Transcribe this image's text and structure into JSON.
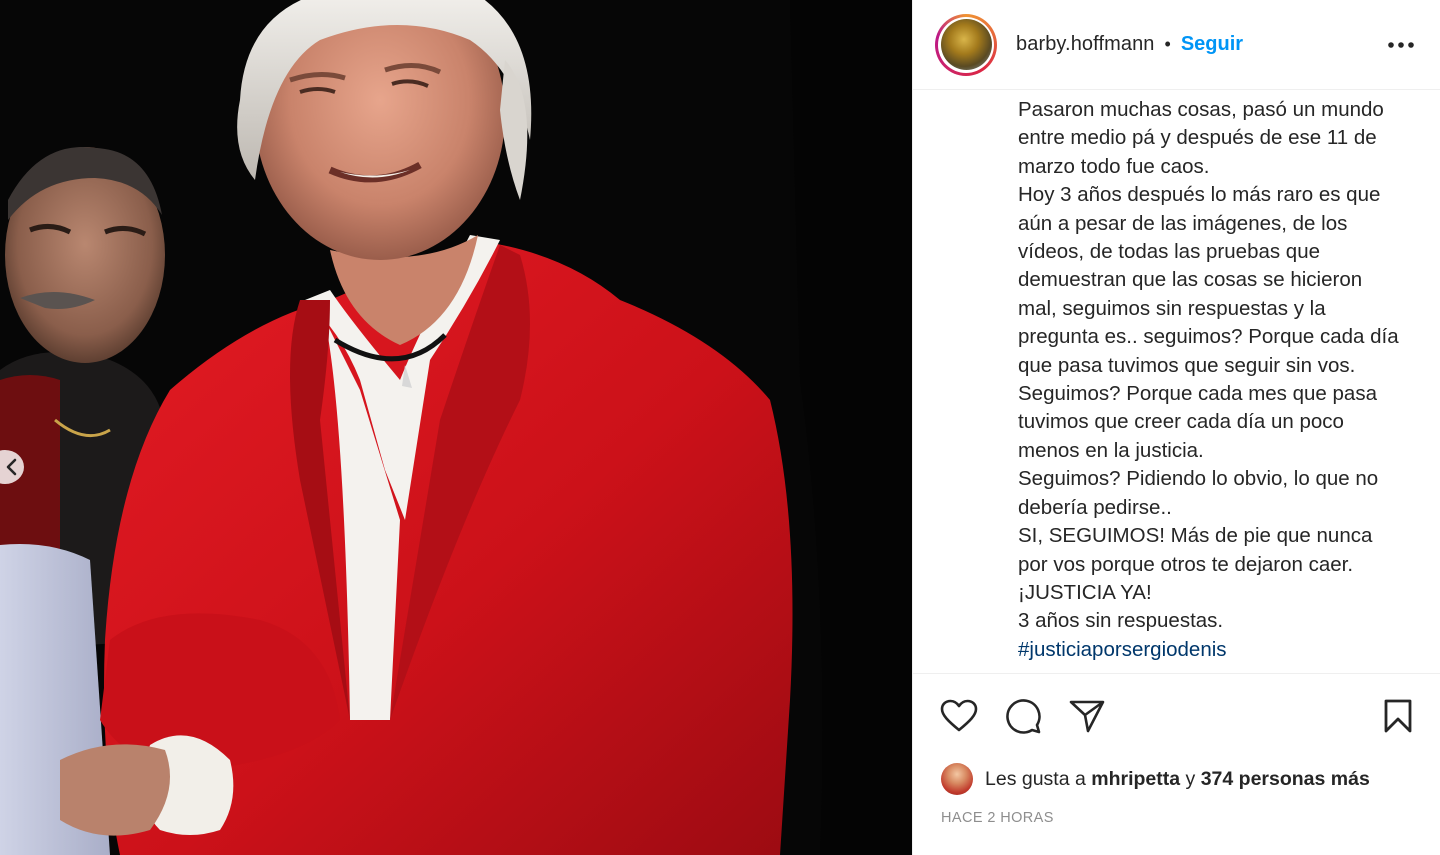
{
  "header": {
    "username": "barby.hoffmann",
    "separator": "•",
    "follow_label": "Seguir"
  },
  "caption": {
    "lines": [
      "Pasaron muchas cosas, pasó un mundo",
      "entre medio pá y después de ese 11 de",
      "marzo todo fue caos.",
      "Hoy 3 años después lo más raro es que",
      "aún a pesar de las imágenes, de los",
      "vídeos, de todas las pruebas que",
      "demuestran que las cosas se hicieron",
      "mal, seguimos sin respuestas y la",
      "pregunta es.. seguimos? Porque cada día",
      "que pasa tuvimos que seguir sin vos.",
      "Seguimos? Porque cada mes que pasa",
      "tuvimos que creer cada día un poco",
      "menos en la justicia.",
      "Seguimos? Pidiendo lo obvio, lo que no",
      "debería pedirse..",
      "SI, SEGUIMOS! Más de pie que nunca",
      "por vos porque otros te dejaron caer.",
      "¡JUSTICIA YA!",
      "3 años sin respuestas."
    ],
    "hashtag": "#justiciaporsergiodenis"
  },
  "actions": {
    "like_icon": "heart-icon",
    "comment_icon": "comment-icon",
    "share_icon": "share-icon",
    "save_icon": "bookmark-icon"
  },
  "likes": {
    "prefix": "Les gusta a",
    "user": "mhripetta",
    "connector": "y",
    "others": "374 personas más"
  },
  "timestamp": "HACE 2 HORAS",
  "colors": {
    "follow_blue": "#0095f6",
    "hashtag": "#00376b",
    "meta_gray": "#8e8e8e",
    "jacket_red": "#d9141e"
  }
}
